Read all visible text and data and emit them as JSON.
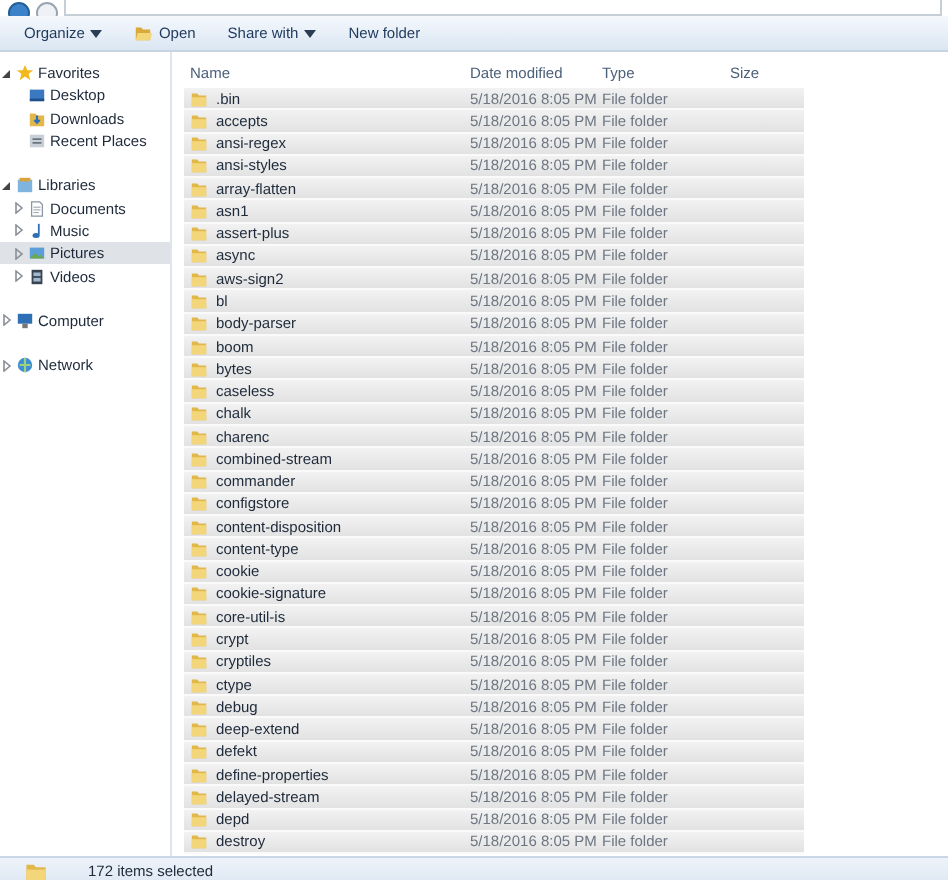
{
  "toolbar": {
    "buttons": [
      {
        "label": "Organize",
        "dropdown": true
      },
      {
        "label": "Open",
        "dropdown": false
      },
      {
        "label": "Share with",
        "dropdown": true
      },
      {
        "label": "New folder",
        "dropdown": false
      }
    ]
  },
  "sidebar": {
    "items": [
      {
        "label": "Favorites",
        "expanded": true,
        "selected": false,
        "children": [
          {
            "label": "Desktop",
            "selected": false
          },
          {
            "label": "Downloads",
            "selected": false
          },
          {
            "label": "Recent Places",
            "selected": false
          }
        ]
      },
      {
        "label": "Libraries",
        "expanded": true,
        "selected": false,
        "children": [
          {
            "label": "Documents",
            "expanded": false,
            "selected": false
          },
          {
            "label": "Music",
            "expanded": false,
            "selected": false
          },
          {
            "label": "Pictures",
            "expanded": false,
            "selected": true
          },
          {
            "label": "Videos",
            "expanded": false,
            "selected": false
          }
        ]
      },
      {
        "label": "Computer",
        "expanded": false,
        "selected": false
      },
      {
        "label": "Network",
        "expanded": false,
        "selected": false
      }
    ]
  },
  "table": {
    "columns": [
      "Name",
      "Date modified",
      "Type",
      "Size"
    ],
    "rows": [
      {
        "name": ".bin",
        "date": "5/18/2016 8:05 PM",
        "type": "File folder",
        "selected": true
      },
      {
        "name": "accepts",
        "date": "5/18/2016 8:05 PM",
        "type": "File folder",
        "selected": true
      },
      {
        "name": "ansi-regex",
        "date": "5/18/2016 8:05 PM",
        "type": "File folder",
        "selected": true
      },
      {
        "name": "ansi-styles",
        "date": "5/18/2016 8:05 PM",
        "type": "File folder",
        "selected": true
      },
      {
        "name": "array-flatten",
        "date": "5/18/2016 8:05 PM",
        "type": "File folder",
        "selected": true
      },
      {
        "name": "asn1",
        "date": "5/18/2016 8:05 PM",
        "type": "File folder",
        "selected": true
      },
      {
        "name": "assert-plus",
        "date": "5/18/2016 8:05 PM",
        "type": "File folder",
        "selected": true
      },
      {
        "name": "async",
        "date": "5/18/2016 8:05 PM",
        "type": "File folder",
        "selected": true
      },
      {
        "name": "aws-sign2",
        "date": "5/18/2016 8:05 PM",
        "type": "File folder",
        "selected": true
      },
      {
        "name": "bl",
        "date": "5/18/2016 8:05 PM",
        "type": "File folder",
        "selected": true
      },
      {
        "name": "body-parser",
        "date": "5/18/2016 8:05 PM",
        "type": "File folder",
        "selected": true
      },
      {
        "name": "boom",
        "date": "5/18/2016 8:05 PM",
        "type": "File folder",
        "selected": true
      },
      {
        "name": "bytes",
        "date": "5/18/2016 8:05 PM",
        "type": "File folder",
        "selected": true
      },
      {
        "name": "caseless",
        "date": "5/18/2016 8:05 PM",
        "type": "File folder",
        "selected": true
      },
      {
        "name": "chalk",
        "date": "5/18/2016 8:05 PM",
        "type": "File folder",
        "selected": true
      },
      {
        "name": "charenc",
        "date": "5/18/2016 8:05 PM",
        "type": "File folder",
        "selected": true
      },
      {
        "name": "combined-stream",
        "date": "5/18/2016 8:05 PM",
        "type": "File folder",
        "selected": true
      },
      {
        "name": "commander",
        "date": "5/18/2016 8:05 PM",
        "type": "File folder",
        "selected": true
      },
      {
        "name": "configstore",
        "date": "5/18/2016 8:05 PM",
        "type": "File folder",
        "selected": true
      },
      {
        "name": "content-disposition",
        "date": "5/18/2016 8:05 PM",
        "type": "File folder",
        "selected": true
      },
      {
        "name": "content-type",
        "date": "5/18/2016 8:05 PM",
        "type": "File folder",
        "selected": true
      },
      {
        "name": "cookie",
        "date": "5/18/2016 8:05 PM",
        "type": "File folder",
        "selected": true
      },
      {
        "name": "cookie-signature",
        "date": "5/18/2016 8:05 PM",
        "type": "File folder",
        "selected": true
      },
      {
        "name": "core-util-is",
        "date": "5/18/2016 8:05 PM",
        "type": "File folder",
        "selected": true
      },
      {
        "name": "crypt",
        "date": "5/18/2016 8:05 PM",
        "type": "File folder",
        "selected": true
      },
      {
        "name": "cryptiles",
        "date": "5/18/2016 8:05 PM",
        "type": "File folder",
        "selected": true
      },
      {
        "name": "ctype",
        "date": "5/18/2016 8:05 PM",
        "type": "File folder",
        "selected": true
      },
      {
        "name": "debug",
        "date": "5/18/2016 8:05 PM",
        "type": "File folder",
        "selected": true
      },
      {
        "name": "deep-extend",
        "date": "5/18/2016 8:05 PM",
        "type": "File folder",
        "selected": true
      },
      {
        "name": "defekt",
        "date": "5/18/2016 8:05 PM",
        "type": "File folder",
        "selected": true
      },
      {
        "name": "define-properties",
        "date": "5/18/2016 8:05 PM",
        "type": "File folder",
        "selected": true
      },
      {
        "name": "delayed-stream",
        "date": "5/18/2016 8:05 PM",
        "type": "File folder",
        "selected": true
      },
      {
        "name": "depd",
        "date": "5/18/2016 8:05 PM",
        "type": "File folder",
        "selected": true
      },
      {
        "name": "destroy",
        "date": "5/18/2016 8:05 PM",
        "type": "File folder",
        "selected": true
      }
    ]
  },
  "status_bar": {
    "text": "172 items selected"
  }
}
